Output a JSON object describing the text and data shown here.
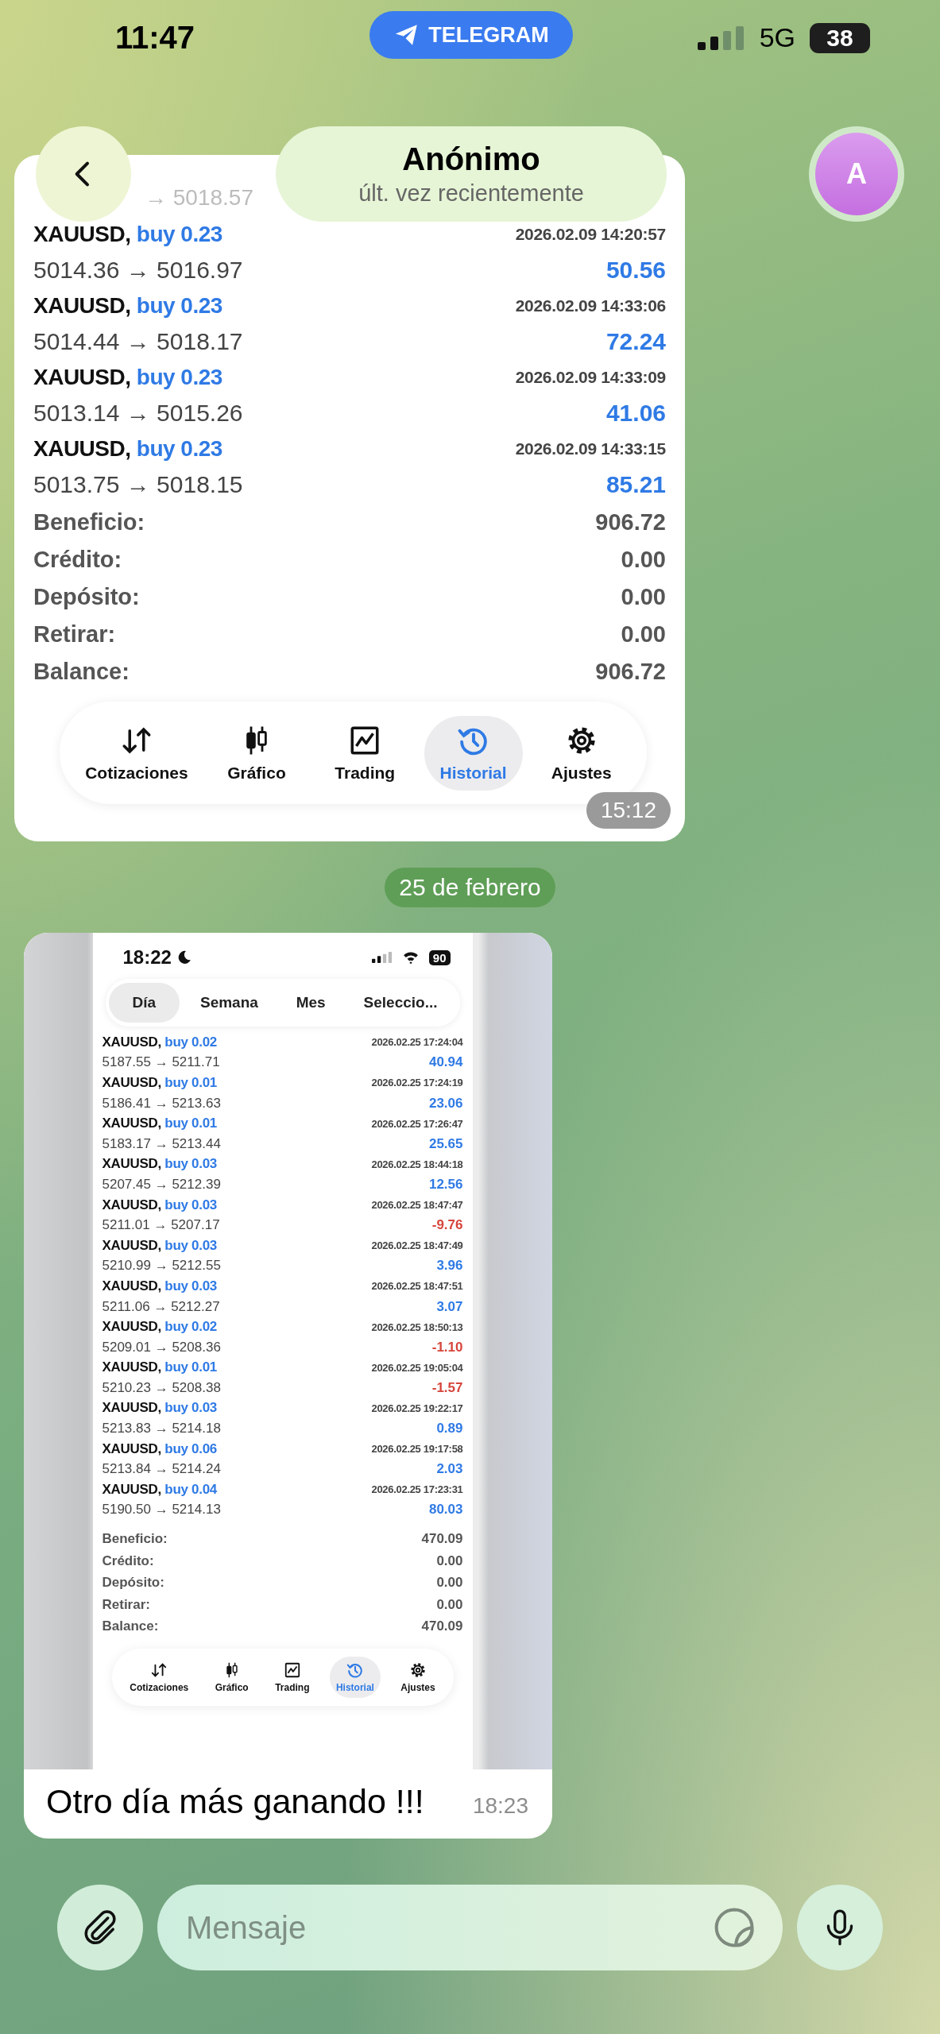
{
  "status_bar": {
    "time": "11:47",
    "app_pill": "TELEGRAM",
    "network": "5G",
    "battery": "38"
  },
  "header": {
    "title": "Anónimo",
    "subtitle": "últ. vez recientemente",
    "avatar_letter": "A"
  },
  "messages": [
    {
      "kind": "history_screenshot",
      "partial_line": "→ 5018.57",
      "trades": [
        {
          "symbol": "XAUUSD,",
          "side": "buy 0.23",
          "time": "2026.02.09 14:20:57",
          "prices": "5014.36 → 5016.97",
          "profit": "50.56",
          "loss": false
        },
        {
          "symbol": "XAUUSD,",
          "side": "buy 0.23",
          "time": "2026.02.09 14:33:06",
          "prices": "5014.44 → 5018.17",
          "profit": "72.24",
          "loss": false
        },
        {
          "symbol": "XAUUSD,",
          "side": "buy 0.23",
          "time": "2026.02.09 14:33:09",
          "prices": "5013.14 → 5015.26",
          "profit": "41.06",
          "loss": false
        },
        {
          "symbol": "XAUUSD,",
          "side": "buy 0.23",
          "time": "2026.02.09 14:33:15",
          "prices": "5013.75 → 5018.15",
          "profit": "85.21",
          "loss": false
        }
      ],
      "summary": [
        {
          "label": "Beneficio:",
          "value": "906.72"
        },
        {
          "label": "Crédito:",
          "value": "0.00"
        },
        {
          "label": "Depósito:",
          "value": "0.00"
        },
        {
          "label": "Retirar:",
          "value": "0.00"
        },
        {
          "label": "Balance:",
          "value": "906.72"
        }
      ],
      "nav": [
        {
          "label": "Cotizaciones",
          "selected": false
        },
        {
          "label": "Gráfico",
          "selected": false
        },
        {
          "label": "Trading",
          "selected": false
        },
        {
          "label": "Historial",
          "selected": true
        },
        {
          "label": "Ajustes",
          "selected": false
        }
      ],
      "time": "15:12"
    },
    {
      "kind": "date",
      "text": "25 de febrero"
    },
    {
      "kind": "photo_caption",
      "screenshot": {
        "time": "18:22",
        "battery": "90",
        "periods": [
          {
            "label": "Día",
            "selected": true
          },
          {
            "label": "Semana",
            "selected": false
          },
          {
            "label": "Mes",
            "selected": false
          },
          {
            "label": "Seleccio...",
            "selected": false
          }
        ],
        "trades": [
          {
            "symbol": "XAUUSD,",
            "side": "buy 0.02",
            "time": "2026.02.25 17:24:04",
            "prices": "5187.55 → 5211.71",
            "profit": "40.94",
            "loss": false
          },
          {
            "symbol": "XAUUSD,",
            "side": "buy 0.01",
            "time": "2026.02.25 17:24:19",
            "prices": "5186.41 → 5213.63",
            "profit": "23.06",
            "loss": false
          },
          {
            "symbol": "XAUUSD,",
            "side": "buy 0.01",
            "time": "2026.02.25 17:26:47",
            "prices": "5183.17 → 5213.44",
            "profit": "25.65",
            "loss": false
          },
          {
            "symbol": "XAUUSD,",
            "side": "buy 0.03",
            "time": "2026.02.25 18:44:18",
            "prices": "5207.45 → 5212.39",
            "profit": "12.56",
            "loss": false
          },
          {
            "symbol": "XAUUSD,",
            "side": "buy 0.03",
            "time": "2026.02.25 18:47:47",
            "prices": "5211.01 → 5207.17",
            "profit": "-9.76",
            "loss": true
          },
          {
            "symbol": "XAUUSD,",
            "side": "buy 0.03",
            "time": "2026.02.25 18:47:49",
            "prices": "5210.99 → 5212.55",
            "profit": "3.96",
            "loss": false
          },
          {
            "symbol": "XAUUSD,",
            "side": "buy 0.03",
            "time": "2026.02.25 18:47:51",
            "prices": "5211.06 → 5212.27",
            "profit": "3.07",
            "loss": false
          },
          {
            "symbol": "XAUUSD,",
            "side": "buy 0.02",
            "time": "2026.02.25 18:50:13",
            "prices": "5209.01 → 5208.36",
            "profit": "-1.10",
            "loss": true
          },
          {
            "symbol": "XAUUSD,",
            "side": "buy 0.01",
            "time": "2026.02.25 19:05:04",
            "prices": "5210.23 → 5208.38",
            "profit": "-1.57",
            "loss": true
          },
          {
            "symbol": "XAUUSD,",
            "side": "buy 0.03",
            "time": "2026.02.25 19:22:17",
            "prices": "5213.83 → 5214.18",
            "profit": "0.89",
            "loss": false
          },
          {
            "symbol": "XAUUSD,",
            "side": "buy 0.06",
            "time": "2026.02.25 19:17:58",
            "prices": "5213.84 → 5214.24",
            "profit": "2.03",
            "loss": false
          },
          {
            "symbol": "XAUUSD,",
            "side": "buy 0.04",
            "time": "2026.02.25 17:23:31",
            "prices": "5190.50 → 5214.13",
            "profit": "80.03",
            "loss": false
          }
        ],
        "summary": [
          {
            "label": "Beneficio:",
            "value": "470.09"
          },
          {
            "label": "Crédito:",
            "value": "0.00"
          },
          {
            "label": "Depósito:",
            "value": "0.00"
          },
          {
            "label": "Retirar:",
            "value": "0.00"
          },
          {
            "label": "Balance:",
            "value": "470.09"
          }
        ],
        "nav": [
          {
            "label": "Cotizaciones",
            "selected": false
          },
          {
            "label": "Gráfico",
            "selected": false
          },
          {
            "label": "Trading",
            "selected": false
          },
          {
            "label": "Historial",
            "selected": true
          },
          {
            "label": "Ajustes",
            "selected": false
          }
        ]
      },
      "caption": "Otro día más ganando !!!",
      "time": "18:23"
    }
  ],
  "composer": {
    "placeholder": "Mensaje"
  }
}
